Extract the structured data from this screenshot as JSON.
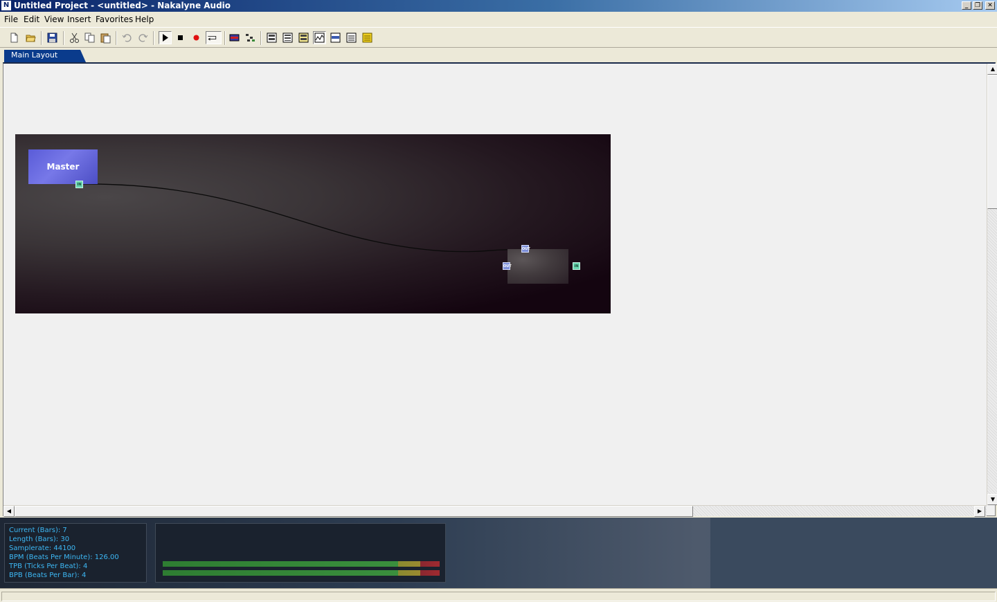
{
  "window": {
    "title": "Untitled Project - <untitled> - Nakalyne Audio",
    "app_icon": "nakalyne-logo-icon",
    "controls": {
      "minimize": "_",
      "restore": "❐",
      "close": "✕"
    }
  },
  "menubar": [
    "File",
    "Edit",
    "View",
    "Insert",
    "Favorites",
    "Help"
  ],
  "toolbar": {
    "buttons": [
      {
        "name": "new-document-icon"
      },
      {
        "name": "open-folder-icon"
      },
      {
        "name": "save-icon"
      },
      {
        "name": "cut-icon"
      },
      {
        "name": "copy-icon"
      },
      {
        "name": "paste-icon"
      },
      {
        "name": "undo-icon"
      },
      {
        "name": "redo-icon"
      },
      {
        "name": "play-icon"
      },
      {
        "name": "stop-icon"
      },
      {
        "name": "record-icon"
      },
      {
        "name": "loop-icon"
      },
      {
        "name": "mixer-icon"
      },
      {
        "name": "pattern-icon"
      },
      {
        "name": "view-1-icon"
      },
      {
        "name": "view-2-icon"
      },
      {
        "name": "view-3-icon"
      },
      {
        "name": "view-4-icon"
      },
      {
        "name": "view-5-icon"
      },
      {
        "name": "view-6-icon"
      },
      {
        "name": "notes-icon"
      }
    ]
  },
  "tabs": [
    {
      "label": "Main Layout",
      "active": true
    }
  ],
  "layout": {
    "master_node": {
      "label": "Master"
    },
    "ports": {
      "in": "IN",
      "out": "OUT"
    }
  },
  "status": {
    "current": "Current (Bars): 7",
    "length": "Length (Bars): 30",
    "samplerate": "Samplerate: 44100",
    "bpm": "BPM (Beats Per Minute): 126.00",
    "tpb": "TPB (Ticks Per Beat): 4",
    "bpb": "BPB (Beats Per Bar): 4"
  },
  "meters": {
    "left_level": 0.93,
    "right_level": 0.93
  },
  "colors": {
    "accent": "#0a3b8c",
    "master_node": "#6667e0",
    "status_text": "#3db8f5",
    "meter_green": "#2e7d32",
    "meter_yellow": "#8a8a30",
    "meter_red": "#a02a30"
  }
}
